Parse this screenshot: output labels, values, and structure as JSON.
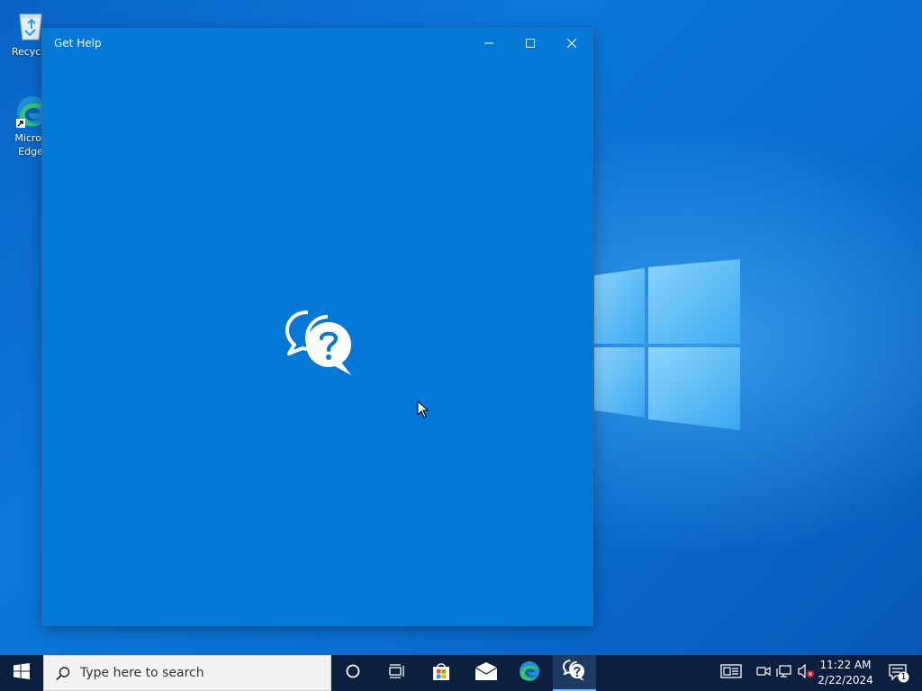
{
  "desktop": {
    "icons": [
      {
        "label": "Recycle",
        "icon": "recycle-bin-icon"
      },
      {
        "label": "Micros",
        "label2": "Edge",
        "icon": "edge-icon"
      }
    ]
  },
  "window": {
    "title": "Get Help",
    "controls": [
      "minimize-icon",
      "maximize-icon",
      "close-icon"
    ],
    "background": "#0378d7",
    "splash_icon": "help-chat-icon"
  },
  "taskbar": {
    "search_placeholder": "Type here to search",
    "pinned": [
      {
        "name": "cortana",
        "icon": "cortana-circle-icon"
      },
      {
        "name": "task-view",
        "icon": "task-view-icon"
      },
      {
        "name": "microsoft-store",
        "icon": "store-icon"
      },
      {
        "name": "mail",
        "icon": "mail-icon"
      },
      {
        "name": "edge",
        "icon": "edge-icon"
      },
      {
        "name": "get-help",
        "icon": "help-chat-icon",
        "active": true
      }
    ],
    "tray": [
      "news-icon",
      "meet-icon",
      "network-icon",
      "volume-muted-icon"
    ],
    "clock": {
      "time": "11:22 AM",
      "date": "2/22/2024"
    },
    "notifications": {
      "count": "1",
      "icon": "action-center-icon"
    }
  },
  "colors": {
    "taskbar": "#0c1f3e",
    "accent": "#0078d7",
    "active_underline": "#76b9ed"
  }
}
